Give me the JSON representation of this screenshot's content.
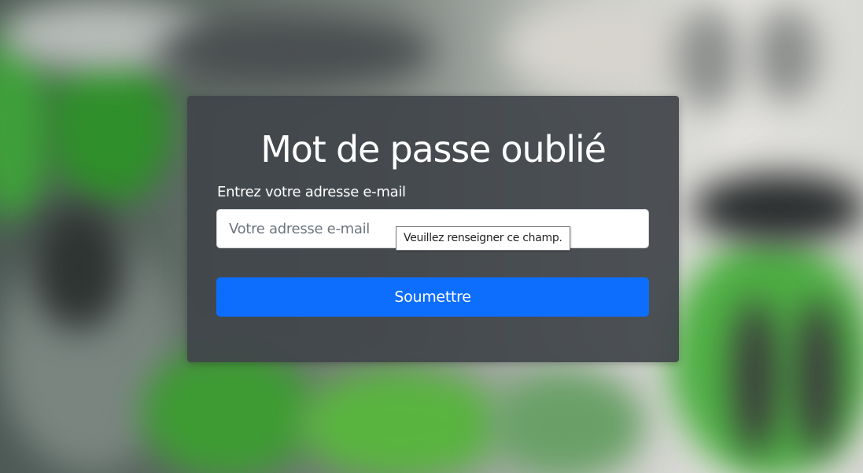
{
  "page": {
    "title": "Mot de passe oublié"
  },
  "form": {
    "email_label": "Entrez votre adresse e-mail",
    "email_value": "",
    "email_placeholder": "Votre adresse e-mail",
    "validation_tooltip": "Veuillez renseigner ce champ.",
    "submit_label": "Soumettre"
  },
  "colors": {
    "button_primary": "#0d6efd",
    "card_background": "#40444a",
    "title_text": "#ffffff"
  }
}
